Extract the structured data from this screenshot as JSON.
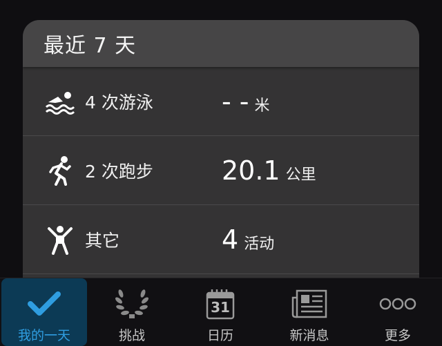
{
  "card": {
    "title": "最近 7 天",
    "rows": [
      {
        "icon": "swim-icon",
        "label": "4 次游泳",
        "value": "- -",
        "unit": "米"
      },
      {
        "icon": "run-icon",
        "label": "2 次跑步",
        "value": "20.1",
        "unit": "公里"
      },
      {
        "icon": "person-activity-icon",
        "label": "其它",
        "value": "4",
        "unit": "活动"
      }
    ]
  },
  "tabbar": {
    "tabs": [
      {
        "label": "我的一天",
        "icon": "checkmark-icon",
        "active": true
      },
      {
        "label": "挑战",
        "icon": "laurel-icon",
        "active": false
      },
      {
        "label": "日历",
        "icon": "calendar-icon",
        "calendar_day": "31",
        "active": false
      },
      {
        "label": "新消息",
        "icon": "news-icon",
        "active": false
      },
      {
        "label": "更多",
        "icon": "more-icon",
        "active": false
      }
    ]
  },
  "colors": {
    "accent": "#2f9de0",
    "active_tab_bg": "#0c3a55",
    "card_bg": "#343334",
    "header_bg": "#464546"
  }
}
